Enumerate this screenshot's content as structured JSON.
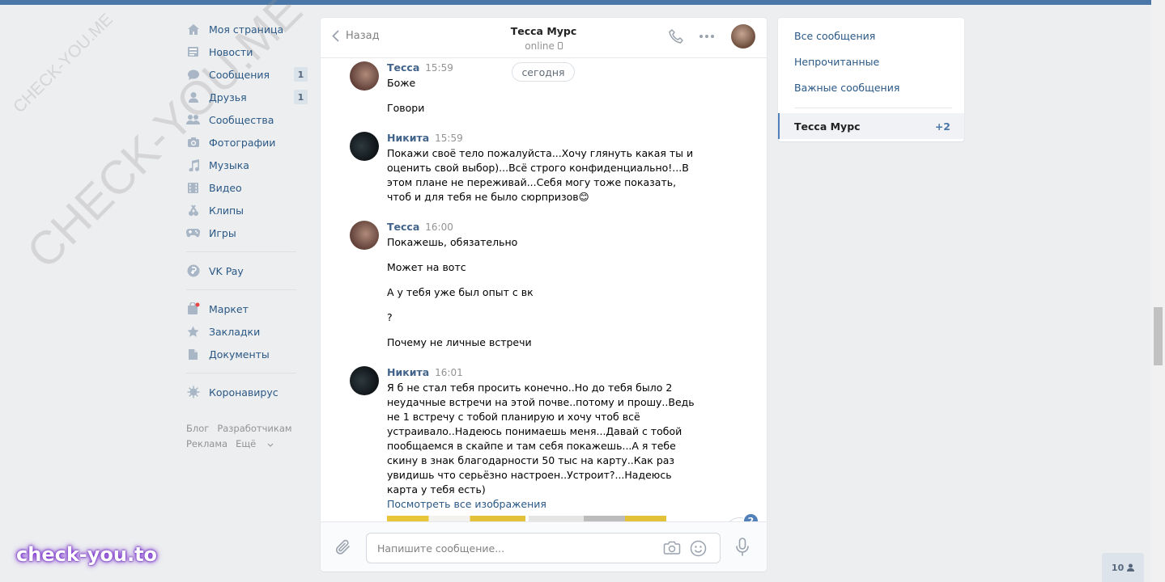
{
  "nav": {
    "items": [
      {
        "label": "Моя страница",
        "icon": "home-icon"
      },
      {
        "label": "Новости",
        "icon": "news-icon"
      },
      {
        "label": "Сообщения",
        "icon": "messages-icon",
        "badge": "1"
      },
      {
        "label": "Друзья",
        "icon": "friends-icon",
        "badge": "1"
      },
      {
        "label": "Сообщества",
        "icon": "communities-icon"
      },
      {
        "label": "Фотографии",
        "icon": "camera-icon"
      },
      {
        "label": "Музыка",
        "icon": "music-icon"
      },
      {
        "label": "Видео",
        "icon": "video-icon"
      },
      {
        "label": "Клипы",
        "icon": "clips-icon"
      },
      {
        "label": "Игры",
        "icon": "games-icon"
      }
    ],
    "vkpay": {
      "label": "VK Pay",
      "icon": "vkpay-icon"
    },
    "items2": [
      {
        "label": "Маркет",
        "icon": "market-icon"
      },
      {
        "label": "Закладки",
        "icon": "bookmark-icon"
      },
      {
        "label": "Документы",
        "icon": "document-icon"
      }
    ],
    "corona": {
      "label": "Коронавирус",
      "icon": "virus-icon"
    },
    "footer": {
      "blog": "Блог",
      "dev": "Разработчикам",
      "ads": "Реклама",
      "more": "Ещё"
    }
  },
  "chat": {
    "back_label": "Назад",
    "peer_name": "Тесса Мурс",
    "peer_status": "online",
    "date_pill": "сегодня",
    "messages": [
      {
        "author": "Тесса",
        "time": "15:59",
        "lines": [
          "Боже",
          "Говори"
        ]
      },
      {
        "author": "Никита",
        "time": "15:59",
        "text": "Покажи своё тело пожалуйста...Хочу глянуть какая ты и оценить свой выбор)...Всё строго конфиденциально!...В этом плане не переживай...Себя могу тоже показать, чтоб и для тебя не было сюрпризов😊"
      },
      {
        "author": "Тесса",
        "time": "16:00",
        "lines": [
          "Покажешь, обязательно",
          "Может на вотс",
          "А у тебя уже был опыт с вк",
          "?",
          "Почему не личные встречи"
        ]
      },
      {
        "author": "Никита",
        "time": "16:01",
        "text": "Я б не стал тебя просить конечно..Но до тебя было 2 неудачные встречи на этой почве..потому и прошу..Ведь не 1 встречу с тобой планирую и хочу чтоб всё устраивало..Надеюсь понимаешь меня...Давай с тобой пообщаемся в скайпе и там себя покажешь...А я тебе скину в знак благодарности 50 тыс на карту..Как раз увидишь что серьёзно настроен..Устроит?...Надеюсь карта у тебя есть)",
        "link": "Посмотреть все изображения"
      }
    ],
    "scroll_badge": "2",
    "composer_placeholder": "Напишите сообщение..."
  },
  "right_panel": {
    "all": "Все сообщения",
    "unread": "Непрочитанные",
    "important": "Важные сообщения",
    "active_name": "Тесса Мурс",
    "active_count": "+2"
  },
  "online_count": "10",
  "watermark": {
    "small": "CHECK-YOU.ME",
    "large": "CHECK-YOU.ME",
    "brand": "check-you.to"
  }
}
